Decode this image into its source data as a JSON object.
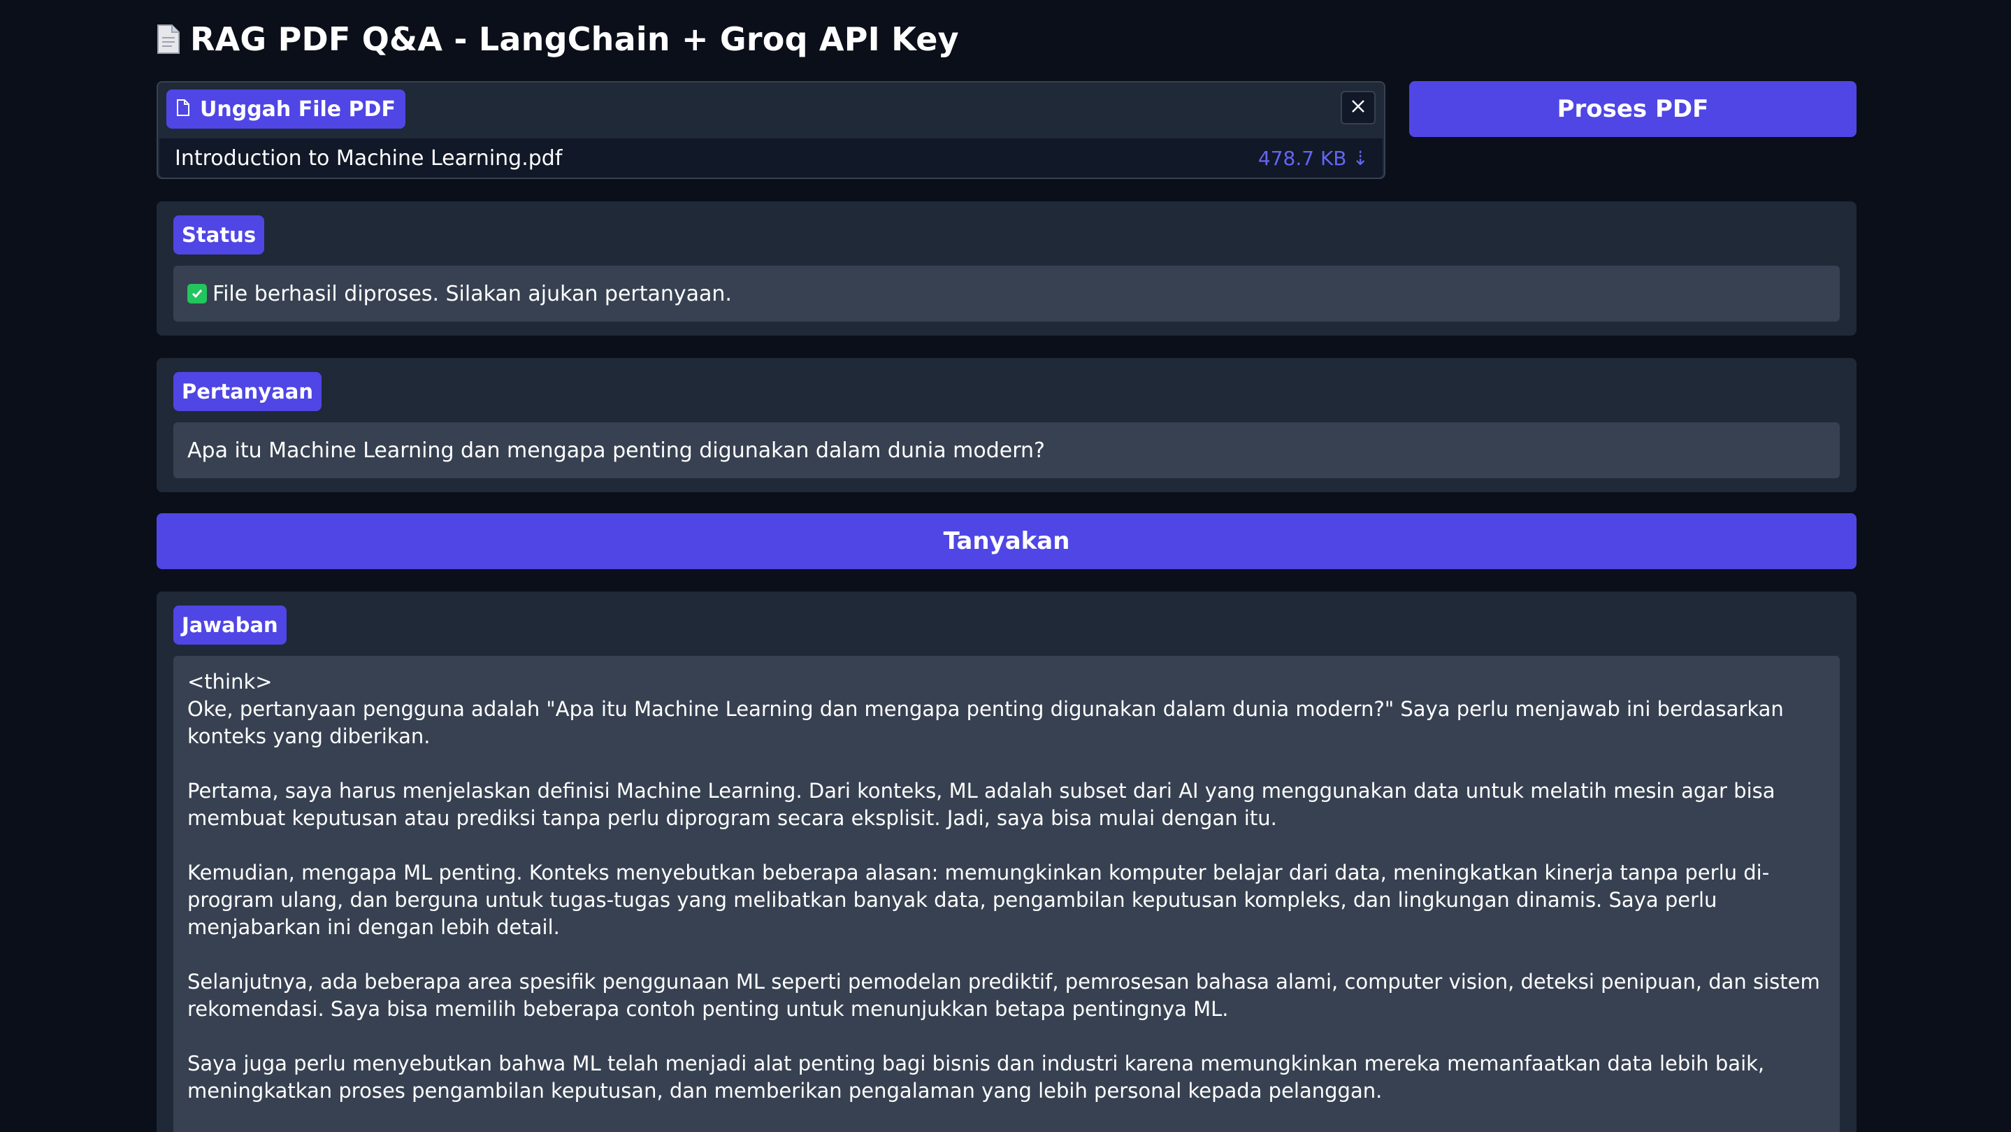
{
  "header": {
    "title": "RAG PDF Q&A - LangChain + Groq API Key",
    "icon": "document-icon"
  },
  "upload": {
    "label": "Unggah File PDF",
    "file_name": "Introduction to Machine Learning.pdf",
    "file_size": "478.7 KB",
    "download_symbol": "⇣"
  },
  "actions": {
    "process_label": "Proses PDF",
    "ask_label": "Tanyakan"
  },
  "status": {
    "label": "Status",
    "text": "File berhasil diproses. Silakan ajukan pertanyaan."
  },
  "question": {
    "label": "Pertanyaan",
    "value": "Apa itu Machine Learning dan mengapa penting digunakan dalam dunia modern?"
  },
  "answer": {
    "label": "Jawaban",
    "think_tag": "<think>",
    "paragraphs": [
      "Oke, pertanyaan pengguna adalah \"Apa itu Machine Learning dan mengapa penting digunakan dalam dunia modern?\" Saya perlu menjawab ini berdasarkan konteks yang diberikan.",
      "Pertama, saya harus menjelaskan definisi Machine Learning. Dari konteks, ML adalah subset dari AI yang menggunakan data untuk melatih mesin agar bisa membuat keputusan atau prediksi tanpa perlu diprogram secara eksplisit. Jadi, saya bisa mulai dengan itu.",
      "Kemudian, mengapa ML penting. Konteks menyebutkan beberapa alasan: memungkinkan komputer belajar dari data, meningkatkan kinerja tanpa perlu di-program ulang, dan berguna untuk tugas-tugas yang melibatkan banyak data, pengambilan keputusan kompleks, dan lingkungan dinamis. Saya perlu menjabarkan ini dengan lebih detail.",
      "Selanjutnya, ada beberapa area spesifik penggunaan ML seperti pemodelan prediktif, pemrosesan bahasa alami, computer vision, deteksi penipuan, dan sistem rekomendasi. Saya bisa memilih beberapa contoh penting untuk menunjukkan betapa pentingnya ML.",
      "Saya juga perlu menyebutkan bahwa ML telah menjadi alat penting bagi bisnis dan industri karena memungkinkan mereka memanfaatkan data lebih baik, meningkatkan proses pengambilan keputusan, dan memberikan pengalaman yang lebih personal kepada pelanggan."
    ]
  },
  "colors": {
    "background": "#0b0f19",
    "panel": "#1f2937",
    "input": "#374151",
    "accent": "#4f46e5",
    "file_size": "#6366f1",
    "success": "#22c55e"
  }
}
